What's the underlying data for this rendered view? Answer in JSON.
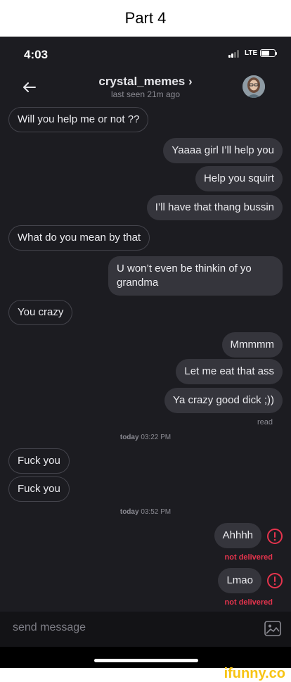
{
  "caption": "Part 4",
  "status_bar": {
    "time": "4:03",
    "network": "LTE"
  },
  "header": {
    "contact_name": "crystal_memes ›",
    "last_seen": "last seen 21m ago"
  },
  "messages": [
    {
      "direction": "in",
      "text": "Will you help me or not ??"
    },
    {
      "direction": "out",
      "text": "Yaaaa girl I’ll help you"
    },
    {
      "direction": "out",
      "text": "Help you squirt"
    },
    {
      "direction": "out",
      "text": "I’ll have that thang bussin"
    },
    {
      "direction": "in",
      "text": "What do you mean by that"
    },
    {
      "direction": "out",
      "text": "U won’t even be thinkin of yo grandma"
    },
    {
      "direction": "in",
      "text": "You crazy"
    },
    {
      "direction": "out",
      "text": "Mmmmm"
    },
    {
      "direction": "out",
      "text": "Let me eat that ass"
    },
    {
      "direction": "out",
      "text": "Ya crazy good dick ;))"
    },
    {
      "direction": "in",
      "text": "Fuck you"
    },
    {
      "direction": "in",
      "text": "Fuck you"
    },
    {
      "direction": "out",
      "text": "Ahhhh",
      "error": true
    },
    {
      "direction": "out",
      "text": "Lmao",
      "error": true
    }
  ],
  "read_status": "read",
  "timestamps": [
    {
      "day": "today",
      "time": "03:22 PM"
    },
    {
      "day": "today",
      "time": "03:52 PM"
    }
  ],
  "not_delivered_label": "not delivered",
  "composer": {
    "placeholder": "send message"
  },
  "watermark": "ifunny.co",
  "colors": {
    "background": "#1c1c21",
    "outgoing_bubble": "#35353c",
    "error": "#e5344d",
    "watermark": "#f7c414"
  },
  "icons": {
    "back": "arrow-left-icon",
    "error": "exclamation-circle-icon",
    "attach": "image-icon"
  }
}
